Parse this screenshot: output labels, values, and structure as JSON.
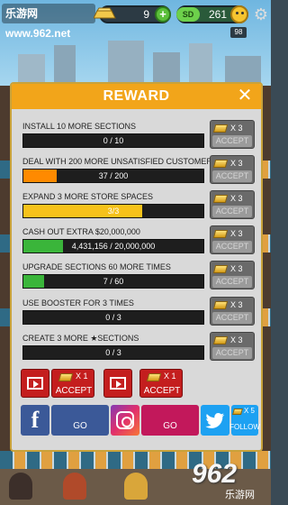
{
  "hud": {
    "watermark": "乐游网 www.962.net",
    "gold": "9",
    "plus": "+",
    "cash_badge": "SD",
    "cash": "261",
    "settings_glyph": "⚙",
    "level": "98"
  },
  "modal": {
    "title": "REWARD",
    "close_glyph": "✕",
    "tasks": [
      {
        "title": "INSTALL 10 MORE SECTIONS",
        "progress": "0 / 10",
        "fill": 0,
        "fill_color": "#ff8a00",
        "reward": "X 3",
        "accept": "ACCEPT"
      },
      {
        "title": "DEAL WITH  200 MORE UNSATISFIED CUSTOMERS",
        "progress": "37 / 200",
        "fill": 0.185,
        "fill_color": "#ff8a00",
        "reward": "X 3",
        "accept": "ACCEPT"
      },
      {
        "title": "EXPAND 3 MORE STORE SPACES",
        "progress": "3/3",
        "fill": 0.66,
        "fill_color": "#f6c21a",
        "reward": "X 3",
        "accept": "ACCEPT"
      },
      {
        "title": "CASH OUT EXTRA $20,000,000",
        "progress": "4,431,156 / 20,000,000",
        "fill": 0.22,
        "fill_color": "#3ab53a",
        "reward": "X 3",
        "accept": "ACCEPT"
      },
      {
        "title": "UPGRADE SECTIONS 60 MORE TIMES",
        "progress": "7 / 60",
        "fill": 0.117,
        "fill_color": "#3ab53a",
        "reward": "X 3",
        "accept": "ACCEPT"
      },
      {
        "title": "USE BOOSTER FOR 3 TIMES",
        "progress": "0 / 3",
        "fill": 0,
        "fill_color": "#3ab53a",
        "reward": "X 3",
        "accept": "ACCEPT"
      },
      {
        "title": "CREATE 3 MORE ★SECTIONS",
        "progress": "0 / 3",
        "fill": 0,
        "fill_color": "#3ab53a",
        "reward": "X 3",
        "accept": "ACCEPT"
      }
    ],
    "video_bonus": [
      {
        "reward": "X 1",
        "accept": "ACCEPT"
      },
      {
        "reward": "X 1",
        "accept": "ACCEPT"
      }
    ],
    "social": {
      "facebook_glyph": "f",
      "facebook_go": "GO",
      "instagram_go": "GO",
      "twitter_reward": "X 5",
      "twitter_follow": "FOLLOW"
    }
  },
  "footer": {
    "brand": "962",
    "brand_sub": "乐游网"
  },
  "colors": {
    "header": "#f2a51a",
    "accept_disabled": "#9b9b9b",
    "video_red": "#c41e1e",
    "facebook": "#3b5998",
    "twitter": "#1da1f2"
  }
}
